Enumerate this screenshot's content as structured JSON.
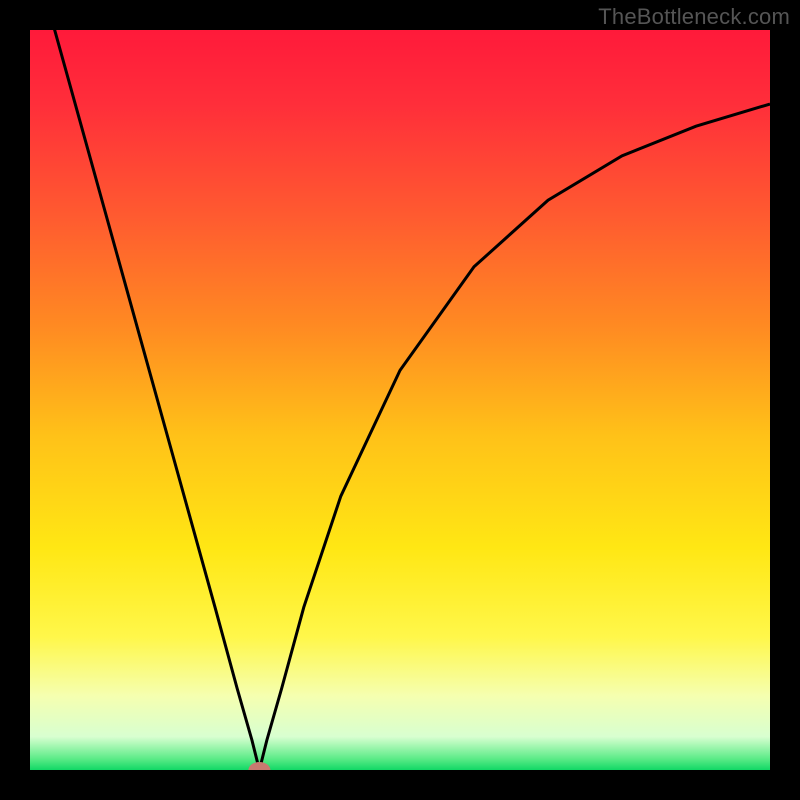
{
  "watermark": "TheBottleneck.com",
  "chart_data": {
    "type": "line",
    "title": "",
    "xlabel": "",
    "ylabel": "",
    "xlim": [
      0,
      1
    ],
    "ylim": [
      0,
      1
    ],
    "x_min_at": 0.31,
    "marker": {
      "x": 0.31,
      "y": 0.0
    },
    "series": [
      {
        "name": "curve",
        "x": [
          0.0,
          0.05,
          0.1,
          0.15,
          0.2,
          0.25,
          0.28,
          0.3,
          0.31,
          0.32,
          0.34,
          0.37,
          0.42,
          0.5,
          0.6,
          0.7,
          0.8,
          0.9,
          1.0
        ],
        "y": [
          1.12,
          0.94,
          0.76,
          0.58,
          0.4,
          0.22,
          0.11,
          0.04,
          0.0,
          0.04,
          0.11,
          0.22,
          0.37,
          0.54,
          0.68,
          0.77,
          0.83,
          0.87,
          0.9
        ]
      }
    ],
    "gradient_stops": [
      {
        "offset": 0.0,
        "color": "#ff1a3a"
      },
      {
        "offset": 0.1,
        "color": "#ff2e3a"
      },
      {
        "offset": 0.25,
        "color": "#ff5a30"
      },
      {
        "offset": 0.4,
        "color": "#ff8a22"
      },
      {
        "offset": 0.55,
        "color": "#ffc218"
      },
      {
        "offset": 0.7,
        "color": "#ffe714"
      },
      {
        "offset": 0.82,
        "color": "#fff74a"
      },
      {
        "offset": 0.9,
        "color": "#f5ffb0"
      },
      {
        "offset": 0.955,
        "color": "#d8ffd0"
      },
      {
        "offset": 0.985,
        "color": "#5beb87"
      },
      {
        "offset": 1.0,
        "color": "#11d865"
      }
    ],
    "marker_color": "#c87a70",
    "curve_color": "#000000"
  }
}
